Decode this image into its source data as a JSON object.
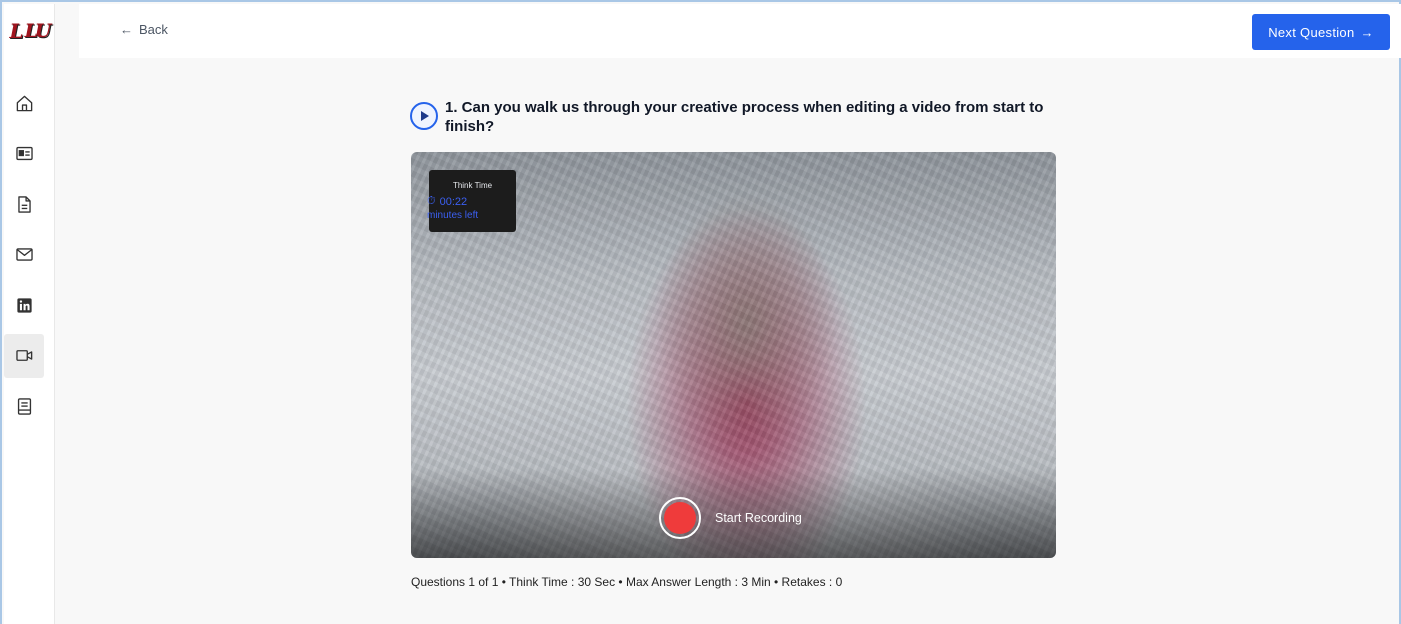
{
  "app": {
    "logo_text_1": "L",
    "logo_text_2": "LU"
  },
  "sidebar": {
    "items": [
      {
        "name": "home",
        "icon": "home-icon",
        "active": false
      },
      {
        "name": "profile",
        "icon": "id-card-icon",
        "active": false
      },
      {
        "name": "documents",
        "icon": "document-icon",
        "active": false
      },
      {
        "name": "messages",
        "icon": "mail-icon",
        "active": false
      },
      {
        "name": "linkedin",
        "icon": "linkedin-icon",
        "active": false
      },
      {
        "name": "video-interview",
        "icon": "video-camera-icon",
        "active": true
      },
      {
        "name": "notes",
        "icon": "notebook-icon",
        "active": false
      }
    ]
  },
  "header": {
    "back_label": "Back",
    "next_label": "Next Question",
    "accent_color": "#2563eb"
  },
  "question": {
    "text": "1. Can you walk us through your creative process when editing a video from start to finish?"
  },
  "video": {
    "think_title": "Think Time",
    "think_time": "00:22",
    "think_sub": "minutes left",
    "record_label": "Start Recording",
    "record_color": "#ef3b3b"
  },
  "footer": {
    "info": "Questions 1 of 1 • Think Time : 30 Sec • Max Answer Length : 3 Min • Retakes : 0"
  }
}
